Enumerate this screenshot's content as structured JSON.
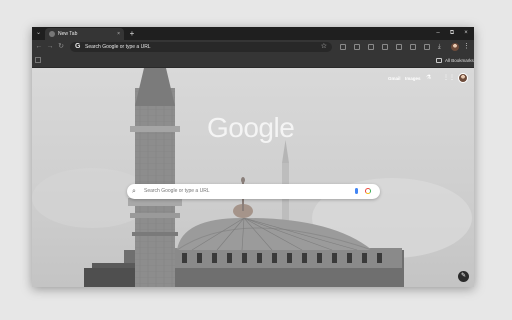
{
  "browser": {
    "tab_title": "New Tab",
    "tab_close": "×",
    "new_tab": "+",
    "window_controls": [
      "–",
      "⧉",
      "×"
    ],
    "omnibox_placeholder": "Search Google or type a URL",
    "bookmark_folder": "All Bookmarks",
    "icons": [
      "tab-search-icon",
      "back-icon",
      "forward-icon",
      "reload-icon",
      "google-g-icon",
      "star-icon",
      "extensions-icon",
      "download-icon",
      "profile-avatar",
      "kebab-menu-icon",
      "folder-icon"
    ]
  },
  "ntp": {
    "gmail_link": "Gmail",
    "images_link": "Images",
    "logo": "Google",
    "search_placeholder": "Search Google or type a URL",
    "icons": [
      "labs-flask-icon",
      "apps-grid-icon",
      "account-avatar",
      "search-icon",
      "mic-icon",
      "lens-icon",
      "pencil-icon"
    ]
  },
  "colors": {
    "frame": "#1f1f1f",
    "toolbar": "#353535",
    "omnibox": "#282828",
    "page_background": "#d0d0d0",
    "mic_blue": "#4285f4",
    "lens_red": "#ea4335"
  }
}
